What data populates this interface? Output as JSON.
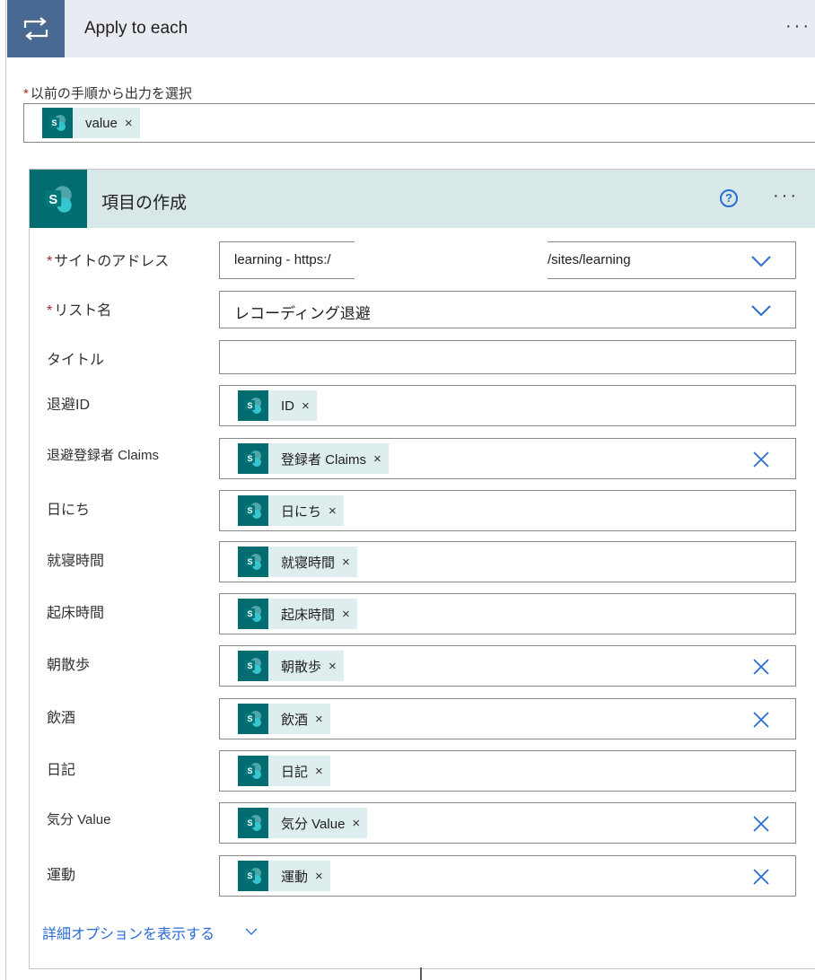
{
  "apply_to_each": {
    "title": "Apply to each",
    "more": "···",
    "select_label": "以前の手順から出力を選択",
    "required_mark": "*",
    "token": {
      "label": "value",
      "remove": "×"
    }
  },
  "action": {
    "title": "項目の作成",
    "help": "?",
    "more": "···",
    "fields": {
      "site_address": {
        "label": "サイトのアドレス",
        "required": "*",
        "value_start": "learning - https:/",
        "value_end": "/sites/learning"
      },
      "list_name": {
        "label": "リスト名",
        "required": "*",
        "value": "レコーディング退避"
      },
      "title_field": {
        "label": "タイトル",
        "value": ""
      },
      "taihi_id": {
        "label": "退避ID",
        "token": "ID"
      },
      "registrant_claims": {
        "label": "退避登録者 Claims",
        "token": "登録者 Claims"
      },
      "date": {
        "label": "日にち",
        "token": "日にち"
      },
      "bedtime": {
        "label": "就寝時間",
        "token": "就寝時間"
      },
      "wakeup": {
        "label": "起床時間",
        "token": "起床時間"
      },
      "morning_walk": {
        "label": "朝散歩",
        "token": "朝散歩"
      },
      "drinking": {
        "label": "飲酒",
        "token": "飲酒"
      },
      "diary": {
        "label": "日記",
        "token": "日記"
      },
      "mood_value": {
        "label": "気分 Value",
        "token": "気分 Value"
      },
      "exercise": {
        "label": "運動",
        "token": "運動"
      }
    },
    "token_remove": "×",
    "advanced_options": "詳細オプションを表示する"
  },
  "icons": {
    "loop": "loop-icon",
    "sharepoint": "sharepoint-icon",
    "chevron": "chevron-down-icon",
    "clear": "clear-icon",
    "help": "help-icon"
  },
  "colors": {
    "apply_header_bg": "#e8ebf2",
    "apply_icon_bg": "#486991",
    "card_header_bg": "#d8e8e9",
    "sharepoint": "#036c70",
    "token_bg": "#deedee",
    "link": "#2b6cd6",
    "required": "#a4262c"
  }
}
